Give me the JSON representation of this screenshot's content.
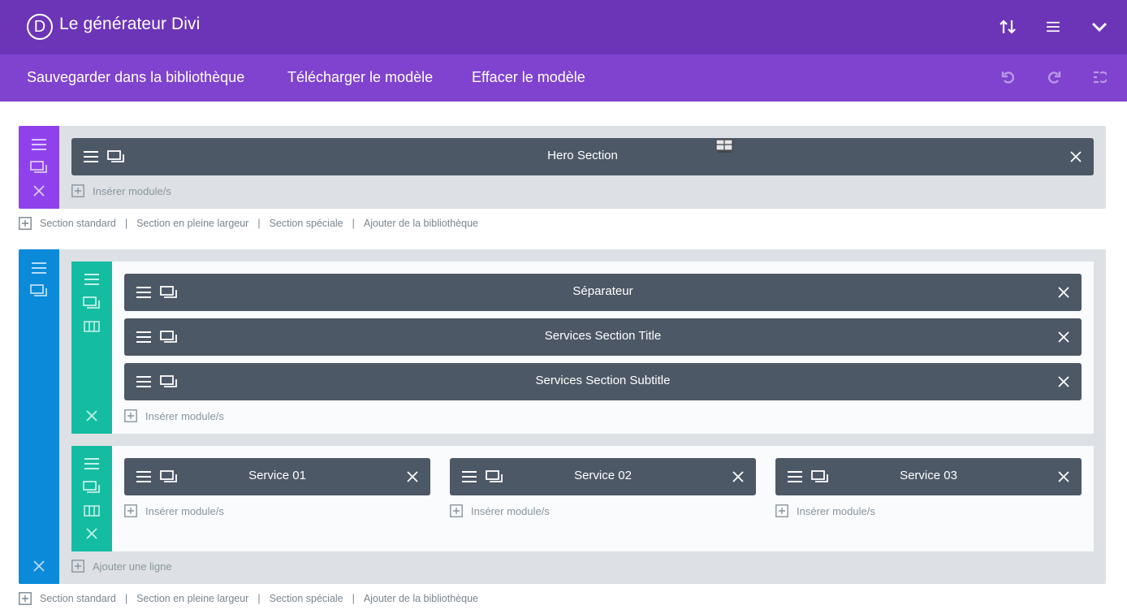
{
  "header": {
    "logo_letter": "D",
    "title": "Le générateur Divi",
    "icons": [
      "sort-arrows-icon",
      "hamburger-menu-icon",
      "chevron-down-icon"
    ]
  },
  "menu": {
    "items": [
      "Sauvegarder dans la bibliothèque",
      "Télécharger le modèle",
      "Effacer le modèle"
    ],
    "history_icons": [
      "undo-icon",
      "redo-icon",
      "history-icon"
    ]
  },
  "section1": {
    "module_label": "Hero Section",
    "insert_label": "Insérer module/s"
  },
  "section_links": {
    "standard": "Section standard",
    "fullwidth": "Section en pleine largeur",
    "special": "Section spéciale",
    "library": "Ajouter de la bibliothèque",
    "separator": "|"
  },
  "section2": {
    "row1": {
      "modules": [
        "Séparateur",
        "Services Section Title",
        "Services Section Subtitle"
      ],
      "insert_label": "Insérer module/s"
    },
    "row2": {
      "columns": [
        {
          "module": "Service 01",
          "insert": "Insérer module/s"
        },
        {
          "module": "Service 02",
          "insert": "Insérer module/s"
        },
        {
          "module": "Service 03",
          "insert": "Insérer module/s"
        }
      ]
    },
    "add_row_label": "Ajouter une ligne"
  },
  "colors": {
    "header_bg": "#6c35b8",
    "menu_bg": "#7f43cf",
    "section_handle_purple": "#8f42ec",
    "section_handle_blue": "#0b8ad9",
    "row_handle_teal": "#14bca2",
    "module_bg": "#4c5866",
    "section_bg": "#dde1e5"
  }
}
